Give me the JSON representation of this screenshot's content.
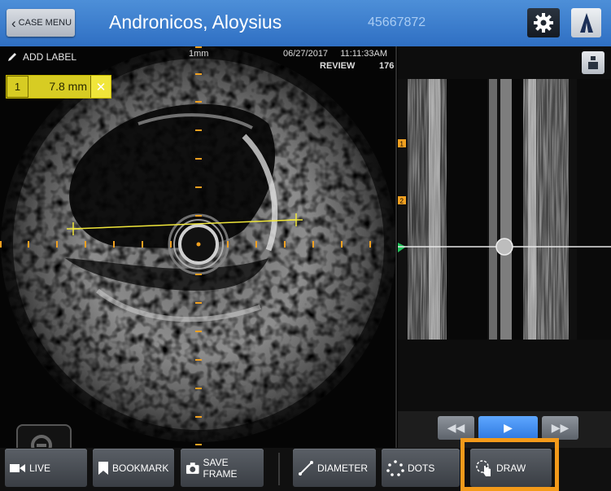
{
  "header": {
    "case_menu_label": "CASE MENU",
    "patient_name": "Andronicos, Aloysius",
    "patient_id": "45667872"
  },
  "ivus": {
    "add_label": "ADD LABEL",
    "measurement": {
      "index": "1",
      "value": "7.8 mm"
    },
    "scale": "1mm",
    "datetime": "06/27/2017     11:11:33AM",
    "mode": "REVIEW",
    "frame": "176"
  },
  "longitudinal": {
    "bookmarks": [
      "1",
      "2"
    ]
  },
  "playback": {
    "rewind": "◀◀",
    "play": "▶",
    "ffwd": "▶▶"
  },
  "toolbar": {
    "live": "LIVE",
    "bookmark": "BOOKMARK",
    "save_frame": "SAVE FRAME",
    "diameter": "DIAMETER",
    "dots": "DOTS",
    "draw": "DRAW"
  },
  "colors": {
    "header_blue": "#2f6fc3",
    "measure_yellow": "#f0e63a",
    "highlight_orange": "#f39a1a",
    "play_blue": "#2e78e0",
    "tick_orange": "#f0a020"
  }
}
